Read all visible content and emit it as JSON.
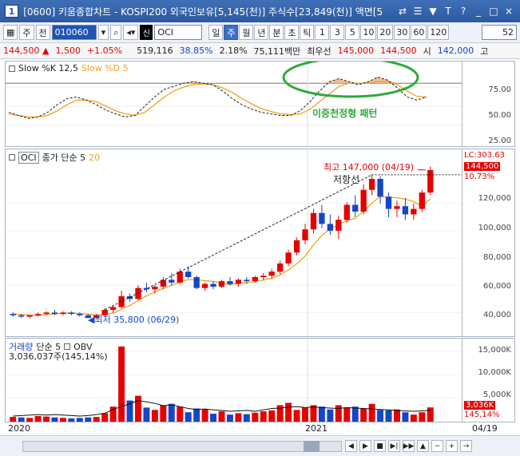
{
  "window": {
    "num": "1",
    "title": "[0600] 키움종합차트 - KOSPI200 외국인보유[5,145(천)] 주식수[23,849(천)] 액면[5",
    "controls": [
      "⇄",
      "☰",
      "▼",
      "T",
      "?",
      "_",
      "□",
      "×"
    ]
  },
  "toolbar": {
    "btn_jong": "주",
    "btn_jeon": "전",
    "code": "010060",
    "sin": "신",
    "name": "OCI",
    "periods": [
      "일",
      "주",
      "월",
      "년",
      "분",
      "초",
      "틱",
      "1",
      "3",
      "5",
      "10",
      "20",
      "30",
      "60",
      "120"
    ],
    "active_period": "주",
    "zoom": "52"
  },
  "infobar": {
    "price": "144,500",
    "arrow": "▲",
    "change": "1,500",
    "change_pct": "+1.05%",
    "volume": "519,116",
    "ratio": "38.85%",
    "turnover": "2.18%",
    "amount": "75,111백만",
    "best_label": "최우선",
    "ask": "145,000",
    "bid": "144,500",
    "open_label": "시",
    "open": "142,000",
    "high_label": "고"
  },
  "stochastic": {
    "label_k": "Slow %K 12,5",
    "label_d": "Slow %D 5",
    "annotation": "이중천정형 패턴",
    "ticks": [
      "75.00",
      "50.00",
      "25.00"
    ],
    "k": [
      42,
      38,
      34,
      36,
      42,
      52,
      60,
      62,
      58,
      52,
      45,
      40,
      36,
      38,
      50,
      62,
      72,
      76,
      80,
      82,
      80,
      78,
      70,
      60,
      52,
      46,
      42,
      40,
      38,
      38,
      44,
      56,
      70,
      82,
      86,
      82,
      78,
      82,
      88,
      84,
      74,
      62,
      58,
      62
    ],
    "d": [
      40,
      38,
      36,
      36,
      38,
      44,
      52,
      58,
      58,
      56,
      50,
      44,
      40,
      38,
      42,
      52,
      62,
      70,
      75,
      78,
      79,
      78,
      74,
      68,
      60,
      53,
      47,
      43,
      40,
      39,
      40,
      46,
      56,
      66,
      76,
      80,
      80,
      80,
      82,
      82,
      78,
      70,
      63,
      62
    ]
  },
  "price_chart": {
    "legend_name": "OCI",
    "legend_ma": "종가 단순 5",
    "legend_ma_val": "20",
    "high_label": "최고 147,000 (04/19)",
    "low_label": "최저 35,800 (06/29)",
    "resistance_label": "저항선",
    "lc_label": "LC:303.63",
    "last_price": "144,500",
    "last_pct": "10.73%",
    "ticks": [
      "120,000",
      "100,000",
      "80,000",
      "60,000",
      "40,000"
    ],
    "candles": [
      [
        39,
        40,
        37,
        38
      ],
      [
        38,
        39,
        36,
        37
      ],
      [
        37,
        38,
        36,
        38
      ],
      [
        38,
        40,
        37,
        39
      ],
      [
        39,
        41,
        38,
        40
      ],
      [
        40,
        42,
        38,
        39
      ],
      [
        39,
        41,
        38,
        40
      ],
      [
        40,
        41,
        38,
        39
      ],
      [
        39,
        40,
        37,
        38
      ],
      [
        38,
        39,
        35.8,
        36
      ],
      [
        36,
        39,
        35.8,
        38
      ],
      [
        38,
        43,
        37,
        42
      ],
      [
        42,
        45,
        40,
        44
      ],
      [
        44,
        56,
        43,
        52
      ],
      [
        52,
        54,
        48,
        50
      ],
      [
        50,
        60,
        49,
        58
      ],
      [
        58,
        62,
        55,
        57
      ],
      [
        57,
        60,
        54,
        59
      ],
      [
        59,
        66,
        57,
        64
      ],
      [
        64,
        69,
        60,
        62
      ],
      [
        62,
        72,
        61,
        70
      ],
      [
        70,
        74,
        65,
        66
      ],
      [
        66,
        67,
        57,
        58
      ],
      [
        58,
        62,
        56,
        61
      ],
      [
        61,
        63,
        57,
        59
      ],
      [
        59,
        64,
        58,
        63
      ],
      [
        63,
        66,
        60,
        61
      ],
      [
        61,
        65,
        59,
        64
      ],
      [
        64,
        66,
        61,
        63
      ],
      [
        63,
        67,
        62,
        66
      ],
      [
        66,
        69,
        64,
        67
      ],
      [
        67,
        72,
        65,
        70
      ],
      [
        70,
        78,
        68,
        76
      ],
      [
        76,
        86,
        74,
        84
      ],
      [
        84,
        95,
        82,
        93
      ],
      [
        93,
        105,
        90,
        101
      ],
      [
        101,
        116,
        98,
        113
      ],
      [
        113,
        119,
        102,
        105
      ],
      [
        105,
        112,
        97,
        100
      ],
      [
        100,
        111,
        94,
        108
      ],
      [
        108,
        121,
        106,
        119
      ],
      [
        119,
        126,
        110,
        114
      ],
      [
        114,
        134,
        112,
        130
      ],
      [
        130,
        141,
        126,
        138
      ],
      [
        138,
        140,
        120,
        125
      ],
      [
        125,
        128,
        110,
        116
      ],
      [
        116,
        122,
        110,
        118
      ],
      [
        118,
        124,
        108,
        112
      ],
      [
        112,
        120,
        108,
        116
      ],
      [
        116,
        130,
        114,
        128
      ],
      [
        128,
        147,
        126,
        144.5
      ]
    ],
    "ma": [
      39,
      38.6,
      38.2,
      38,
      38.4,
      39,
      39.4,
      39.6,
      39.4,
      38.8,
      38.2,
      38.6,
      39.6,
      42.4,
      45.2,
      48.8,
      52.2,
      55.2,
      57.6,
      60,
      62.4,
      64.2,
      64,
      63.4,
      62.8,
      61.8,
      60.4,
      61.6,
      62,
      62.6,
      63.8,
      65.2,
      67.6,
      71.2,
      75.8,
      81.4,
      89.6,
      96.6,
      101.4,
      104.4,
      107.4,
      109.2,
      114.2,
      120.2,
      125.2,
      124.6,
      124.2,
      123.2,
      121.4,
      118,
      123.3
    ]
  },
  "volume_chart": {
    "legend_name": "거래량",
    "legend_ma": "단순 5",
    "legend_obv": "OBV",
    "sub_label": "3,036,037주(145,14%)",
    "ticks": [
      "15,000K",
      "10,000K",
      "5,000K"
    ],
    "last_vol": "3,036K",
    "last_pct": "145,14%",
    "values": [
      1.0,
      0.9,
      0.8,
      1.2,
      1.1,
      0.9,
      0.8,
      0.7,
      0.8,
      0.9,
      1.0,
      1.8,
      3.2,
      16.0,
      4.5,
      5.5,
      3.0,
      2.5,
      3.5,
      3.8,
      3.2,
      2.0,
      2.8,
      2.6,
      1.7,
      2.2,
      1.5,
      1.8,
      1.6,
      1.9,
      2.2,
      2.4,
      3.5,
      4.0,
      2.5,
      3.0,
      3.5,
      3.2,
      2.6,
      3.5,
      3.0,
      3.2,
      2.8,
      3.8,
      2.5,
      2.4,
      2.6,
      2.0,
      1.5,
      2.0,
      3.03
    ],
    "ups": [
      1,
      0,
      1,
      1,
      1,
      0,
      1,
      0,
      0,
      0,
      1,
      1,
      1,
      1,
      0,
      1,
      0,
      1,
      1,
      0,
      1,
      0,
      0,
      1,
      0,
      1,
      0,
      1,
      0,
      1,
      1,
      1,
      1,
      1,
      1,
      1,
      1,
      0,
      0,
      1,
      1,
      0,
      1,
      1,
      0,
      0,
      1,
      0,
      1,
      1,
      1
    ],
    "obv": [
      1.2,
      1.3,
      1.4,
      1.5,
      1.4,
      1.5,
      1.4,
      1.3,
      1.2,
      1.3,
      1.5,
      1.8,
      2.6,
      3.2,
      3.8,
      4.5,
      4.2,
      3.9,
      3.4,
      3.6,
      3.2,
      2.8,
      2.6,
      2.7,
      2.5,
      2.4,
      2.2,
      2.3,
      2.4,
      2.2,
      2.5,
      2.8,
      2.9,
      3.1,
      3.2,
      3.0,
      3.1,
      3.0,
      2.9,
      2.8,
      3.0,
      2.9,
      2.8,
      2.7,
      2.6,
      2.5,
      2.4,
      2.3,
      2.2,
      2.3,
      2.4
    ]
  },
  "dates": {
    "start": "2020",
    "mid": "2021",
    "end": "04/19"
  },
  "colors": {
    "up": "#e60000",
    "down": "#1446c8",
    "ma": "#f0a21e",
    "stoch_d": "#f0a21e",
    "stoch_k": "#222222",
    "annotation": "#2eaa3a",
    "highlight": "#f4b183"
  }
}
